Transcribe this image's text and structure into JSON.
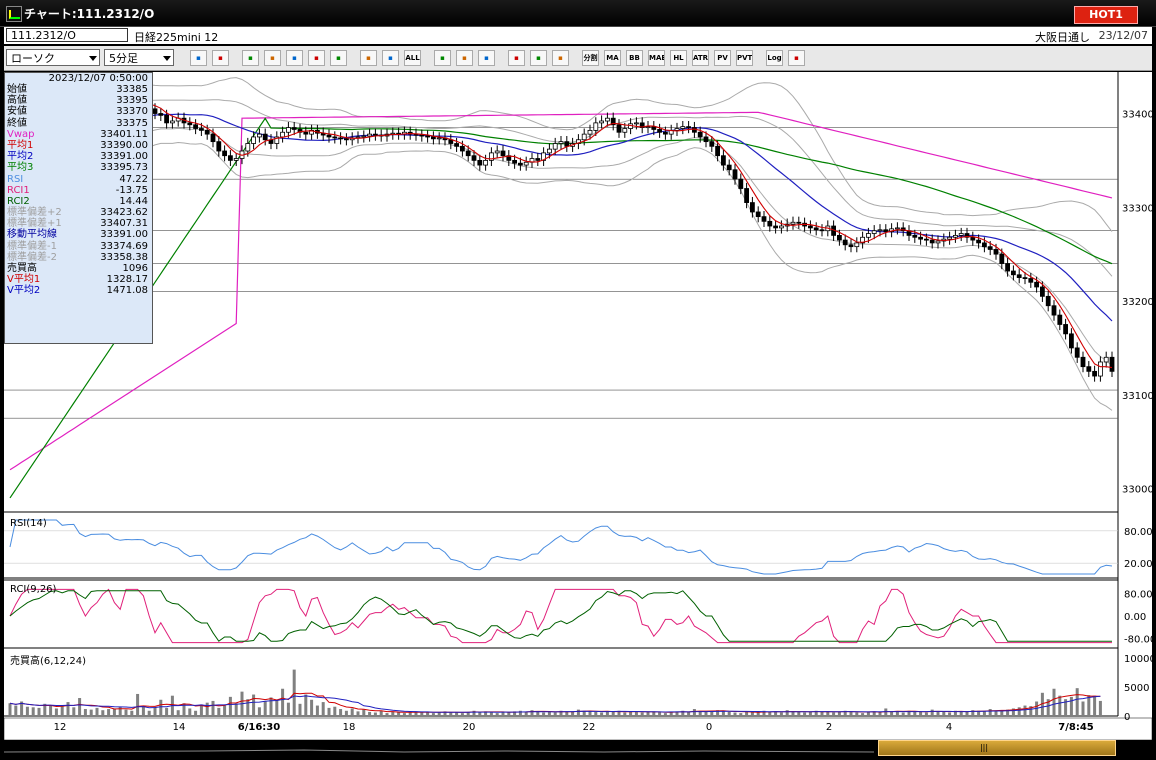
{
  "window": {
    "title": "チャート:111.2312/O",
    "hot_button": "HOT1"
  },
  "infobar": {
    "symbol": "111.2312/O",
    "product": "日経225mini 12",
    "session": "大阪日通し",
    "date": "23/12/07"
  },
  "toolbar": {
    "chart_type": "ローソク",
    "interval": "5分足",
    "buttons": [
      "search-icon",
      "cursor-icon",
      "bell-icon",
      "clock-icon",
      "chart-icon",
      "split-icon",
      "info-icon",
      "candle-icon",
      "candle2-icon",
      "ALL",
      "pen-icon",
      "arrow-icon",
      "flag-icon",
      "gear-icon",
      "wrench-icon",
      "palette-icon",
      "分割",
      "MA",
      "BB",
      "MAE",
      "HL",
      "ATR",
      "PV",
      "PVT",
      "Log",
      "export-icon"
    ]
  },
  "data_panel": {
    "datetime": "2023/12/07 0:50:00",
    "rows": [
      {
        "k": "始値",
        "v": "33385",
        "c": "#000"
      },
      {
        "k": "高値",
        "v": "33395",
        "c": "#000"
      },
      {
        "k": "安値",
        "v": "33370",
        "c": "#000"
      },
      {
        "k": "終値",
        "v": "33375",
        "c": "#000"
      },
      {
        "k": "Vwap",
        "v": "33401.11",
        "c": "#e020c0"
      },
      {
        "k": "平均1",
        "v": "33390.00",
        "c": "#d00000"
      },
      {
        "k": "平均2",
        "v": "33391.00",
        "c": "#0000c0"
      },
      {
        "k": "平均3",
        "v": "33395.73",
        "c": "#008000"
      },
      {
        "k": "RSI",
        "v": "47.22",
        "c": "#5090e0"
      },
      {
        "k": "RCI1",
        "v": "-13.75",
        "c": "#e0207a"
      },
      {
        "k": "RCI2",
        "v": "14.44",
        "c": "#006000"
      },
      {
        "k": "標準偏差+2",
        "v": "33423.62",
        "c": "#a0a0a0"
      },
      {
        "k": "標準偏差+1",
        "v": "33407.31",
        "c": "#a0a0a0"
      },
      {
        "k": "移動平均線",
        "v": "33391.00",
        "c": "#0000a0"
      },
      {
        "k": "標準偏差-1",
        "v": "33374.69",
        "c": "#a0a0a0"
      },
      {
        "k": "標準偏差-2",
        "v": "33358.38",
        "c": "#a0a0a0"
      },
      {
        "k": "売買高",
        "v": "1096",
        "c": "#000"
      },
      {
        "k": "V平均1",
        "v": "1328.17",
        "c": "#d00000"
      },
      {
        "k": "V平均2",
        "v": "1471.08",
        "c": "#0000c0"
      }
    ]
  },
  "panes": {
    "rsi_label": "RSI(14)",
    "rci_label": "RCI(9,26)",
    "vol_label": "売買高(6,12,24)"
  },
  "chart_data": {
    "type": "line",
    "price_axis": {
      "ticks": [
        33000,
        33100,
        33200,
        33300,
        33400
      ],
      "range": [
        32975,
        33440
      ]
    },
    "rsi_axis": {
      "ticks": [
        "80.00",
        "20.00"
      ]
    },
    "rci_axis": {
      "ticks": [
        "80.00",
        "0.00",
        "-80.00"
      ]
    },
    "vol_axis": {
      "ticks": [
        "10000",
        "5000",
        "0"
      ]
    },
    "x_labels": [
      "12",
      "14",
      "6/16:30",
      "18",
      "20",
      "22",
      "0",
      "2",
      "4",
      "7/8:45"
    ],
    "close": [
      33355,
      33362,
      33368,
      33374,
      33378,
      33380,
      33385,
      33390,
      33392,
      33388,
      33394,
      33396,
      33385,
      33380,
      33390,
      33398,
      33405,
      33410,
      33402,
      33400,
      33408,
      33412,
      33415,
      33410,
      33405,
      33400,
      33398,
      33390,
      33392,
      33395,
      33390,
      33388,
      33384,
      33382,
      33378,
      33370,
      33360,
      33355,
      33350,
      33352,
      33360,
      33368,
      33375,
      33378,
      33372,
      33368,
      33375,
      33380,
      33385,
      33383,
      33380,
      33378,
      33382,
      33379,
      33377,
      33375,
      33374,
      33373,
      33372,
      33374,
      33375,
      33376,
      33378,
      33377,
      33376,
      33378,
      33379,
      33378,
      33380,
      33378,
      33377,
      33376,
      33375,
      33373,
      33374,
      33372,
      33368,
      33365,
      33360,
      33355,
      33350,
      33345,
      33350,
      33358,
      33360,
      33355,
      33350,
      33347,
      33345,
      33348,
      33352,
      33350,
      33358,
      33362,
      33368,
      33370,
      33365,
      33368,
      33372,
      33378,
      33382,
      33390,
      33392,
      33395,
      33388,
      33380,
      33384,
      33389,
      33390,
      33385,
      33386,
      33383,
      33380,
      33378,
      33382,
      33384,
      33386,
      33385,
      33380,
      33375,
      33370,
      33365,
      33355,
      33345,
      33340,
      33330,
      33320,
      33305,
      33295,
      33290,
      33285,
      33280,
      33278,
      33280,
      33282,
      33284,
      33283,
      33280,
      33278,
      33276,
      33275,
      33280,
      33270,
      33265,
      33260,
      33258,
      33262,
      33268,
      33272,
      33275,
      33276,
      33274,
      33277,
      33278,
      33275,
      33270,
      33268,
      33266,
      33265,
      33262,
      33264,
      33266,
      33268,
      33270,
      33272,
      33268,
      33265,
      33262,
      33258,
      33255,
      33250,
      33240,
      33232,
      33228,
      33225,
      33224,
      33220,
      33215,
      33205,
      33195,
      33185,
      33175,
      33165,
      33150,
      33140,
      33130,
      33125,
      33120,
      33135,
      33140,
      33125
    ],
    "volume": [
      2200,
      1800,
      2500,
      1600,
      1500,
      1400,
      2100,
      1900,
      1300,
      1800,
      2400,
      1500,
      3100,
      1200,
      1100,
      1400,
      1000,
      1200,
      1300,
      1600,
      1100,
      900,
      3800,
      1700,
      900,
      1500,
      2800,
      1400,
      3500,
      1000,
      2200,
      1300,
      900,
      2000,
      2300,
      2600,
      1400,
      1800,
      3300,
      2200,
      4200,
      2900,
      3700,
      1500,
      2500,
      3200,
      2800,
      4700,
      2300,
      8000,
      2100,
      3700,
      2800,
      1800,
      2400,
      1400,
      1600,
      1200,
      900,
      1300,
      800,
      1100,
      700,
      600,
      900,
      500,
      700,
      600,
      500,
      700,
      800,
      600,
      700,
      500,
      600,
      800,
      700,
      600,
      500,
      700,
      900,
      700,
      800,
      600,
      500,
      700,
      600,
      800,
      900,
      700,
      1000,
      800,
      600,
      700,
      600,
      900,
      800,
      700,
      1100,
      900,
      800,
      700,
      600,
      800,
      700,
      900,
      600,
      800,
      700,
      600,
      700,
      800,
      600,
      500,
      700,
      800,
      900,
      700,
      1200,
      800,
      700,
      900,
      1000,
      800,
      700,
      600,
      500,
      700,
      800,
      600,
      900,
      700,
      800,
      600,
      1000,
      700,
      800,
      600,
      700,
      900,
      700,
      800,
      600,
      700,
      900,
      800,
      600,
      500,
      700,
      800,
      600,
      1300,
      700,
      800,
      600,
      900,
      700,
      800,
      600,
      1100,
      700,
      800,
      600,
      900,
      700,
      800,
      1000,
      900,
      800,
      1200,
      900,
      1000,
      1100,
      1300,
      1500,
      1800,
      1700,
      2500,
      4000,
      2900,
      4700,
      3500,
      2900,
      3300,
      4800,
      2500,
      3600,
      3500,
      2600
    ],
    "indicators": [
      "Vwap",
      "平均1",
      "平均2",
      "平均3",
      "RSI",
      "RCI1",
      "RCI2",
      "BB+2",
      "BB+1",
      "BB-1",
      "BB-2",
      "V平均1",
      "V平均2"
    ]
  },
  "scrollbar": {
    "grip": "|||"
  }
}
